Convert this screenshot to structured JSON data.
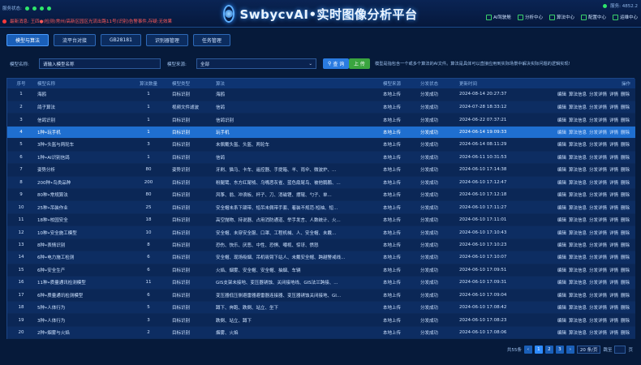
{
  "header": {
    "status_label": "服务状态:",
    "alarm_text": "最新消息: 王四●(检测)常州/高新区园区光流出路11号(识别)告警事件,存疑:无效果",
    "title": "SwbycvAI•实时图像分析平台",
    "right_status": "服务: 4852.2",
    "nav": [
      {
        "label": "AI驾驶舱",
        "icon": "dashboard-icon"
      },
      {
        "label": "分析中心",
        "icon": "analysis-icon"
      },
      {
        "label": "算法中心",
        "icon": "algorithm-icon"
      },
      {
        "label": "配置中心",
        "icon": "config-icon"
      },
      {
        "label": "运维中心",
        "icon": "ops-icon"
      }
    ]
  },
  "tabs": [
    {
      "label": "模型与算法",
      "active": true
    },
    {
      "label": "流平台对接",
      "active": false
    },
    {
      "label": "GB28181",
      "active": false
    },
    {
      "label": "识别器管理",
      "active": false
    },
    {
      "label": "任务管理",
      "active": false
    }
  ],
  "filter": {
    "name_label": "模型名称:",
    "name_placeholder": "请输入模型名称",
    "source_label": "模型来源:",
    "source_value": "全部",
    "query_button": "查 询",
    "upload_button": "上 传",
    "tip": "模型是指包含一个或多个算法的AI文件。算法是具体可以直接应用到实际场景中解决实际问题的逻辑实现!"
  },
  "table": {
    "columns": [
      "序号",
      "模型名称",
      "算法数量",
      "模型类型",
      "算法",
      "模型来源",
      "分发状态",
      "更新时间",
      "操作"
    ],
    "ops": [
      "编辑",
      "算法信息",
      "分发详情",
      "详情",
      "删除"
    ],
    "rows": [
      {
        "idx": "1",
        "name": "海鸥",
        "count": "1",
        "type": "目标识别",
        "alg": "海鸥",
        "src": "本地上传",
        "status": "分发成功",
        "time": "2024-08-14 20:27:37"
      },
      {
        "idx": "2",
        "name": "鸽子算法",
        "count": "1",
        "type": "视频文件滤波",
        "alg": "信鸽",
        "src": "本地上传",
        "status": "分发成功",
        "time": "2024-07-28 18:33:12"
      },
      {
        "idx": "3",
        "name": "信鸽识别",
        "count": "1",
        "type": "目标识别",
        "alg": "信鸽识别",
        "src": "本地上传",
        "status": "分发成功",
        "time": "2024-06-22 07:37:21"
      },
      {
        "idx": "4",
        "name": "1种•玩手机",
        "count": "1",
        "type": "目标识别",
        "alg": "玩手机",
        "src": "本地上传",
        "status": "分发成功",
        "time": "2024-06-14 19:09:33"
      },
      {
        "idx": "5",
        "name": "3种•头盔与两轮车",
        "count": "3",
        "type": "目标识别",
        "alg": "未佩戴头盔、头盔、两轮车",
        "src": "本地上传",
        "status": "分发成功",
        "time": "2024-06-14 08:11:29"
      },
      {
        "idx": "6",
        "name": "1种•AI识别信鸽",
        "count": "1",
        "type": "目标识别",
        "alg": "信鸽",
        "src": "本地上传",
        "status": "分发成功",
        "time": "2024-06-11 10:31:53"
      },
      {
        "idx": "7",
        "name": "姿势分析",
        "count": "80",
        "type": "姿势识别",
        "alg": "牙刷、猫马、卡车、遥控器、手提箱、羊、雨伞、微波炉、...",
        "src": "本地上传",
        "status": "分发成功",
        "time": "2024-06-10 17:14:38"
      },
      {
        "idx": "8",
        "name": "200种•鸟类品种",
        "count": "200",
        "type": "目标识别",
        "alg": "粉腿鹭、东方红尾鸲、乌嘴恶灰雀、蓝色扇尾鸟、被他鹅鹏、...",
        "src": "本地上传",
        "status": "分发成功",
        "time": "2024-06-10 17:12:47"
      },
      {
        "idx": "9",
        "name": "80种•常规算法",
        "count": "80",
        "type": "目标识别",
        "alg": "风筝、翁、冲浪板、杯子、刀、消磁锂、摆辊、勺子、单...",
        "src": "本地上传",
        "status": "分发成功",
        "time": "2024-06-10 17:12:18"
      },
      {
        "idx": "10",
        "name": "25种•吊装作业",
        "count": "25",
        "type": "目标识别",
        "alg": "安全帽未系下颌带、短吊未佩带手套、着装不规范-短袖、短...",
        "src": "本地上传",
        "status": "分发成功",
        "time": "2024-06-10 17:11:27"
      },
      {
        "idx": "11",
        "name": "18种•校园安全",
        "count": "18",
        "type": "目标识别",
        "alg": "高空抛物、持说器、占用消防通道、举手发言、人数统计、火...",
        "src": "本地上传",
        "status": "分发成功",
        "time": "2024-06-10 17:11:01"
      },
      {
        "idx": "12",
        "name": "10种•安全施工模型",
        "count": "10",
        "type": "目标识别",
        "alg": "安全帽、未穿安全服、口罩、工程机械、人、安全帽、未戴...",
        "src": "本地上传",
        "status": "分发成功",
        "time": "2024-06-10 17:10:43"
      },
      {
        "idx": "13",
        "name": "8种•表情识别",
        "count": "8",
        "type": "目标识别",
        "alg": "恐伤、快乐、厌恶、中性、恐惧、嘲视、惊讶、愤怒",
        "src": "本地上传",
        "status": "分发成功",
        "time": "2024-06-10 17:10:23"
      },
      {
        "idx": "14",
        "name": "6种•电力施工检测",
        "count": "6",
        "type": "目标识别",
        "alg": "安全帽、现场吸烟、吊机吸臂下站人、未戴安全帽、跨越警戒线...",
        "src": "本地上传",
        "status": "分发成功",
        "time": "2024-06-10 17:10:07"
      },
      {
        "idx": "15",
        "name": "6种•安全生产",
        "count": "6",
        "type": "目标识别",
        "alg": "火焰、烟雾、安全帽、安全帽、抽烟、车辆",
        "src": "本地上传",
        "status": "分发成功",
        "time": "2024-06-10 17:09:51"
      },
      {
        "idx": "16",
        "name": "11种•质量通讯检测模型",
        "count": "11",
        "type": "目标识别",
        "alg": "GIS支架未接地、变压器锈蚀、关闭接地线、GIS法兰跨接、...",
        "src": "本地上传",
        "status": "分发成功",
        "time": "2024-06-10 17:09:31"
      },
      {
        "idx": "17",
        "name": "6种•质量通讯检测模型",
        "count": "6",
        "type": "目标识别",
        "alg": "变压器低压侧避雷器避雷器连接器、变压器锈蚀关闭接地、GI...",
        "src": "本地上传",
        "status": "分发成功",
        "time": "2024-06-10 17:09:04"
      },
      {
        "idx": "18",
        "name": "5种•人体行为",
        "count": "5",
        "type": "目标识别",
        "alg": "蹲下、奔跑、跌倒、站立、坐下",
        "src": "本地上传",
        "status": "分发成功",
        "time": "2024-06-10 17:08:42"
      },
      {
        "idx": "19",
        "name": "3种•人体行为",
        "count": "3",
        "type": "目标识别",
        "alg": "跌倒、站立、蹲下",
        "src": "本地上传",
        "status": "分发成功",
        "time": "2024-06-10 17:08:23"
      },
      {
        "idx": "20",
        "name": "2种•烟雾与火焰",
        "count": "2",
        "type": "目标识别",
        "alg": "烟雾、火焰",
        "src": "本地上传",
        "status": "分发成功",
        "time": "2024-06-10 17:08:06"
      }
    ]
  },
  "pager": {
    "total": "共55条",
    "pages": [
      "1",
      "2",
      "3"
    ],
    "page_size": "20 条/页",
    "jump_label": "跳至",
    "jump_suffix": "页"
  }
}
